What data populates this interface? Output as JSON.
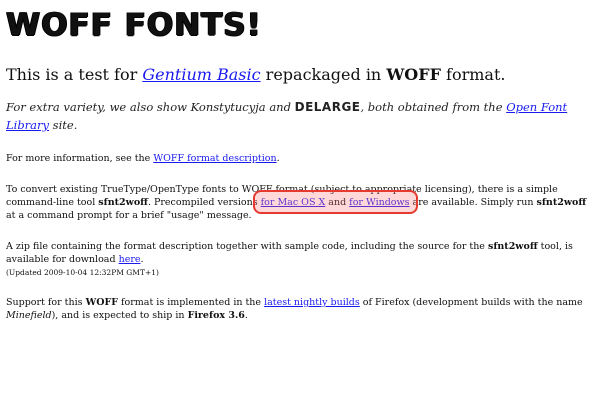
{
  "title": "WOFF FONTS!",
  "intro": {
    "prefix": "This is a test for ",
    "link": "Gentium Basic",
    "middle": " repackaged in ",
    "bold": "WOFF",
    "suffix": " format."
  },
  "variety": {
    "prefix": "For extra variety, we also show ",
    "font1": "Konstytucyja",
    "and": " and ",
    "font2": "DELARGE",
    "middle": ", both obtained from the ",
    "link": "Open Font Library",
    "suffix": " site."
  },
  "more_info": {
    "prefix": "For more information, see the ",
    "link": "WOFF format description",
    "suffix": "."
  },
  "convert": {
    "prefix": "To convert existing TrueType/OpenType fonts to WOFF format (subject to appropriate licensing), there is a simple command-line tool ",
    "tool": "sfnt2woff",
    "middle1": ". Precompiled versions ",
    "link_mac": "for Mac OS X",
    "and": " and ",
    "link_win": "for Windows",
    "middle2": " are available. Simply run ",
    "tool2": "sfnt2woff",
    "suffix": " at a command prompt for a brief \"usage\" message."
  },
  "zip": {
    "prefix": "A zip file containing the format description together with sample code, including the source for the ",
    "tool": "sfnt2woff",
    "middle": " tool, is available for download ",
    "link": "here",
    "suffix": "."
  },
  "updated": "(Updated 2009-10-04 12:32PM GMT+1)",
  "support": {
    "prefix": "Support for this ",
    "bold": "WOFF",
    "middle1": " format is implemented in the ",
    "link": "latest nightly builds",
    "middle2": " of Firefox (development builds with the name ",
    "italic": "Minefield",
    "middle3": "), and is expected to ship in ",
    "bold2": "Firefox 3.6",
    "suffix": "."
  },
  "colors": {
    "link": "#1a1aee",
    "highlight_border": "#e53a2f"
  }
}
